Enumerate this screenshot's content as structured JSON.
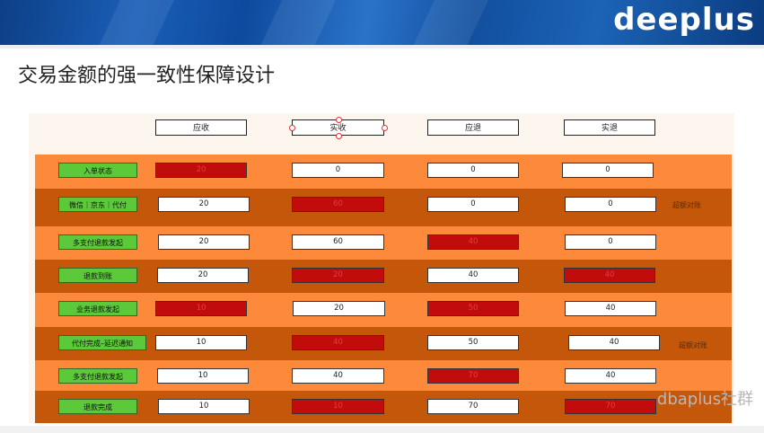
{
  "header": {
    "logo": "deeplus"
  },
  "page_title": "交易金额的强一致性保障设计",
  "columns": [
    "应收",
    "实收",
    "应退",
    "实退"
  ],
  "rows": [
    {
      "label": "入单状态",
      "values": [
        "20",
        "0",
        "0",
        "0"
      ],
      "highlight": [
        true,
        false,
        false,
        false
      ],
      "note": ""
    },
    {
      "label": "微信｜京东｜代付",
      "values": [
        "20",
        "60",
        "0",
        "0"
      ],
      "highlight": [
        false,
        true,
        false,
        false
      ],
      "note": "超额对账"
    },
    {
      "label": "多支付退款发起",
      "values": [
        "20",
        "60",
        "40",
        "0"
      ],
      "highlight": [
        false,
        false,
        true,
        false
      ],
      "note": ""
    },
    {
      "label": "退款到账",
      "values": [
        "20",
        "20",
        "40",
        "40"
      ],
      "highlight": [
        false,
        true,
        false,
        true
      ],
      "note": ""
    },
    {
      "label": "业务退款发起",
      "values": [
        "10",
        "20",
        "50",
        "40"
      ],
      "highlight": [
        true,
        false,
        true,
        false
      ],
      "note": ""
    },
    {
      "label": "代付完成–延迟通知",
      "values": [
        "10",
        "40",
        "50",
        "40"
      ],
      "highlight": [
        false,
        true,
        false,
        false
      ],
      "note": "超额对账"
    },
    {
      "label": "多支付退款发起",
      "values": [
        "10",
        "40",
        "70",
        "40"
      ],
      "highlight": [
        false,
        false,
        true,
        false
      ],
      "note": ""
    },
    {
      "label": "退款完成",
      "values": [
        "10",
        "10",
        "70",
        "70"
      ],
      "highlight": [
        false,
        true,
        false,
        true
      ],
      "note": ""
    }
  ],
  "watermark": "dbaplus社群",
  "colors": {
    "row_light": "#fc8a3a",
    "row_dark": "#c5570b",
    "label_green": "#5cc93a",
    "cell_red": "#c20c0c",
    "banner_blue": "#1a5fb8"
  }
}
